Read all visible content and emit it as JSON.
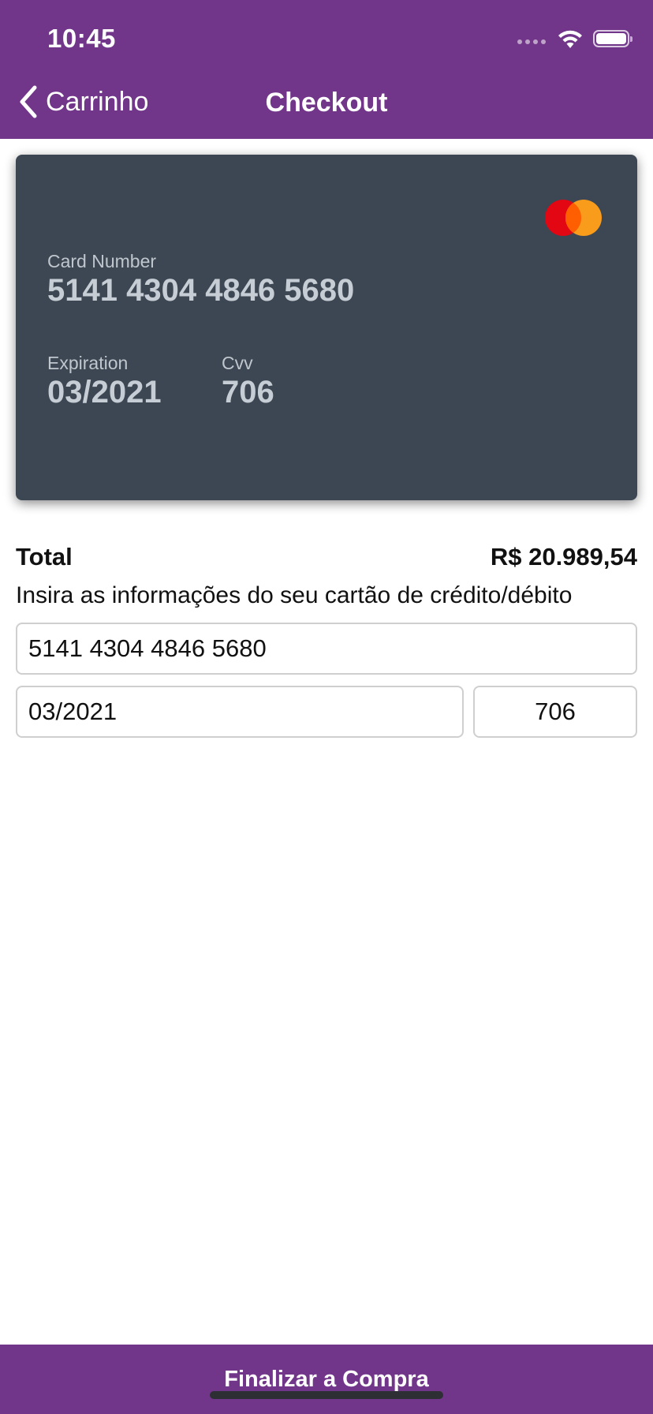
{
  "status_bar": {
    "time": "10:45"
  },
  "nav": {
    "back_label": "Carrinho",
    "title": "Checkout",
    "background_color": "#71368a"
  },
  "card_preview": {
    "brand_icon": "mastercard-icon",
    "number_label": "Card Number",
    "number_value": "5141 4304 4846 5680",
    "expiration_label": "Expiration",
    "expiration_value": "03/2021",
    "cvv_label": "Cvv",
    "cvv_value": "706",
    "background_color": "#3c4753"
  },
  "summary": {
    "total_label": "Total",
    "total_value": "R$ 20.989,54"
  },
  "form": {
    "instructions": "Insira as informações do seu cartão de crédito/débito",
    "card_number_value": "5141 4304 4846 5680",
    "expiration_value": "03/2021",
    "cvv_value": "706"
  },
  "footer": {
    "button_label": "Finalizar a Compra"
  }
}
